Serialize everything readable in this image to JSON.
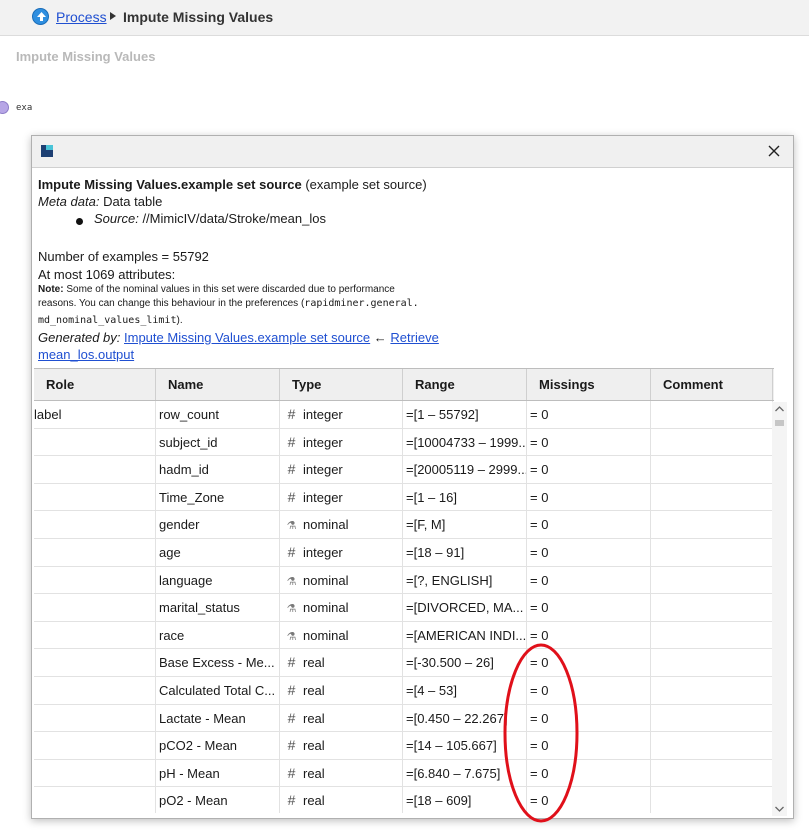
{
  "breadcrumb": {
    "process": "Process",
    "current": "Impute Missing Values"
  },
  "canvas": {
    "title": "Impute Missing Values",
    "port_label": "exa"
  },
  "popup": {
    "heading_bold": "Impute Missing Values.example set source",
    "heading_rest": "(example set source)",
    "meta_label": "Meta data:",
    "meta_value": "Data table",
    "source_label": "Source:",
    "source_value": "//MimicIV/data/Stroke/mean_los",
    "num_examples": "Number of examples = 55792",
    "attributes": "At most 1069 attributes:",
    "note_label": "Note:",
    "note_text1": "Some of the nominal values in this set were discarded due to performance",
    "note_text2": "reasons. You can change this behaviour in the preferences (",
    "note_code1": "rapidminer.general.",
    "note_code2": "md_nominal_values_limit",
    "note_end": ").",
    "generated_label": "Generated by:",
    "generated_link1": "Impute Missing Values.example set source",
    "generated_arrow": "←",
    "generated_link2a": "Retrieve",
    "generated_link2b": "mean_los.output"
  },
  "table": {
    "headers": [
      "Role",
      "Name",
      "Type",
      "Range",
      "Missings",
      "Comment"
    ],
    "rows": [
      {
        "role": "label",
        "name": "row_count",
        "type": "integer",
        "type_icon": "hash-icon",
        "range": "=[1 – 55792]",
        "missings": "= 0"
      },
      {
        "role": "",
        "name": "subject_id",
        "type": "integer",
        "type_icon": "hash-icon",
        "range": "=[10004733 – 1999...",
        "missings": "= 0"
      },
      {
        "role": "",
        "name": "hadm_id",
        "type": "integer",
        "type_icon": "hash-icon",
        "range": "=[20005119 – 2999...",
        "missings": "= 0"
      },
      {
        "role": "",
        "name": "Time_Zone",
        "type": "integer",
        "type_icon": "hash-icon",
        "range": "=[1 – 16]",
        "missings": "= 0"
      },
      {
        "role": "",
        "name": "gender",
        "type": "nominal",
        "type_icon": "nominal-icon",
        "range": "=[F, M]",
        "missings": "= 0"
      },
      {
        "role": "",
        "name": "age",
        "type": "integer",
        "type_icon": "hash-icon",
        "range": "=[18 – 91]",
        "missings": "= 0"
      },
      {
        "role": "",
        "name": "language",
        "type": "nominal",
        "type_icon": "nominal-icon",
        "range": "=[?, ENGLISH]",
        "missings": "= 0"
      },
      {
        "role": "",
        "name": "marital_status",
        "type": "nominal",
        "type_icon": "nominal-icon",
        "range": "=[DIVORCED, MA...",
        "missings": "= 0"
      },
      {
        "role": "",
        "name": "race",
        "type": "nominal",
        "type_icon": "nominal-icon",
        "range": "=[AMERICAN INDI...",
        "missings": "= 0"
      },
      {
        "role": "",
        "name": "Base Excess - Me...",
        "type": "real",
        "type_icon": "hash-icon",
        "range": "=[-30.500 – 26]",
        "missings": "= 0"
      },
      {
        "role": "",
        "name": "Calculated Total C...",
        "type": "real",
        "type_icon": "hash-icon",
        "range": "=[4 – 53]",
        "missings": "= 0"
      },
      {
        "role": "",
        "name": "Lactate - Mean",
        "type": "real",
        "type_icon": "hash-icon",
        "range": "=[0.450 – 22.267]",
        "missings": "= 0"
      },
      {
        "role": "",
        "name": "pCO2 - Mean",
        "type": "real",
        "type_icon": "hash-icon",
        "range": "=[14 – 105.667]",
        "missings": "= 0"
      },
      {
        "role": "",
        "name": "pH - Mean",
        "type": "real",
        "type_icon": "hash-icon",
        "range": "=[6.840 – 7.675]",
        "missings": "= 0"
      },
      {
        "role": "",
        "name": "pO2 - Mean",
        "type": "real",
        "type_icon": "hash-icon",
        "range": "=[18 – 609]",
        "missings": "= 0"
      }
    ]
  },
  "colors": {
    "link": "#1f4fd1",
    "annotation": "#e0101a",
    "header_bg": "#efefef"
  }
}
